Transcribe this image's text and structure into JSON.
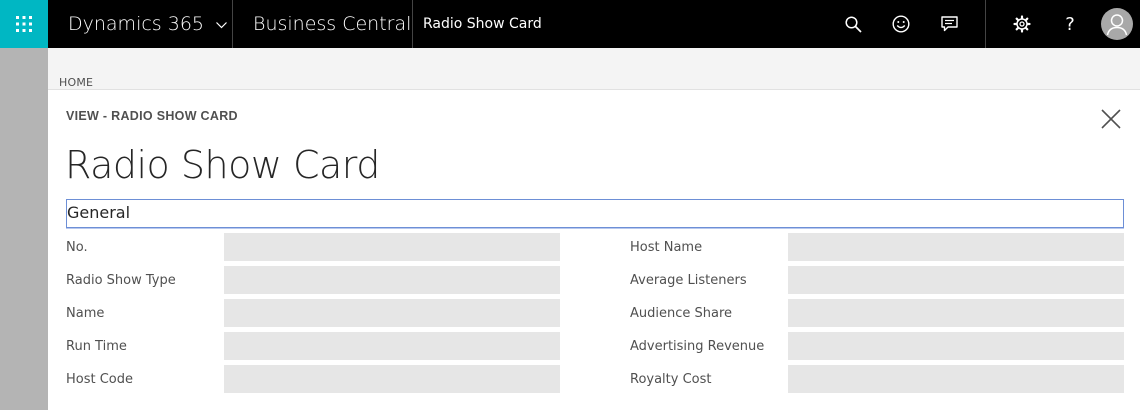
{
  "topbar": {
    "app_name": "Dynamics 365",
    "product": "Business Central",
    "page_name": "Radio Show Card",
    "icons": [
      "waffle-icon",
      "search-icon",
      "smiley-icon",
      "feedback-icon",
      "gear-icon",
      "help-icon",
      "user-icon"
    ],
    "help_glyph": "?"
  },
  "breadcrumb": "HOME",
  "card": {
    "view_label": "VIEW - RADIO SHOW CARD",
    "title": "Radio Show Card",
    "group": "General"
  },
  "fields_left": [
    {
      "label": "No.",
      "value": ""
    },
    {
      "label": "Radio Show Type",
      "value": ""
    },
    {
      "label": "Name",
      "value": ""
    },
    {
      "label": "Run Time",
      "value": ""
    },
    {
      "label": "Host Code",
      "value": ""
    }
  ],
  "fields_right": [
    {
      "label": "Host Name",
      "value": ""
    },
    {
      "label": "Average Listeners",
      "value": ""
    },
    {
      "label": "Audience Share",
      "value": ""
    },
    {
      "label": "Advertising Revenue",
      "value": ""
    },
    {
      "label": "Royalty Cost",
      "value": ""
    }
  ],
  "colors": {
    "accent": "#00b7c3",
    "topbar": "#000000",
    "field_bg": "#e6e6e6",
    "focus_border": "#6d8fd6"
  }
}
